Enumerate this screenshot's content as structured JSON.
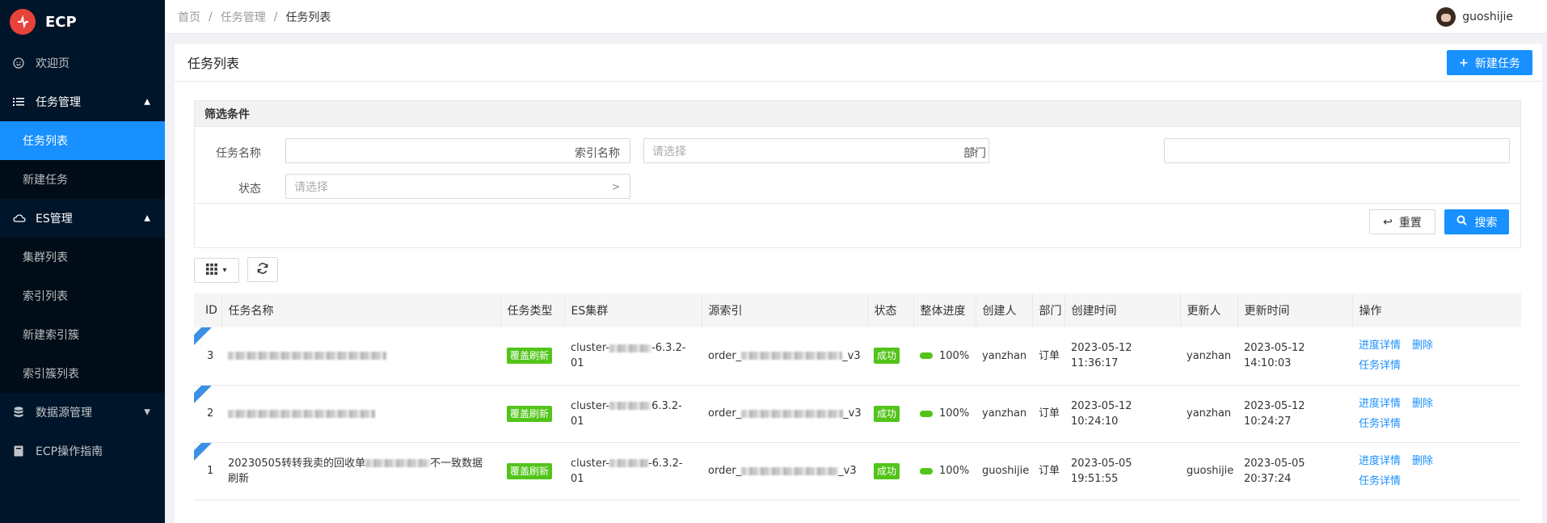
{
  "app": {
    "logo_text": "ECP",
    "brand_color": "#e8433b",
    "accent": "#1890ff"
  },
  "sidebar": {
    "items": [
      {
        "label": "欢迎页",
        "icon": "smile-icon"
      },
      {
        "label": "任务管理",
        "icon": "list-icon",
        "expanded": true,
        "children": [
          {
            "label": "任务列表",
            "active": true
          },
          {
            "label": "新建任务"
          }
        ]
      },
      {
        "label": "ES管理",
        "icon": "cloud-icon",
        "expanded": true,
        "children": [
          {
            "label": "集群列表"
          },
          {
            "label": "索引列表"
          },
          {
            "label": "新建索引簇"
          },
          {
            "label": "索引簇列表"
          }
        ]
      },
      {
        "label": "数据源管理",
        "icon": "database-icon",
        "expanded": false
      },
      {
        "label": "ECP操作指南",
        "icon": "book-icon"
      }
    ]
  },
  "header": {
    "breadcrumb": [
      "首页",
      "任务管理",
      "任务列表"
    ],
    "user": "guoshijie"
  },
  "page": {
    "title": "任务列表",
    "new_button": "新建任务"
  },
  "filter": {
    "title": "筛选条件",
    "task_name_label": "任务名称",
    "index_name_label": "索引名称",
    "index_name_placeholder": "请选择",
    "dept_label": "部门",
    "status_label": "状态",
    "status_placeholder": "请选择",
    "reset_button": "重置",
    "search_button": "搜索"
  },
  "table": {
    "columns": [
      "ID",
      "任务名称",
      "任务类型",
      "ES集群",
      "源索引",
      "状态",
      "整体进度",
      "创建人",
      "部门",
      "创建时间",
      "更新人",
      "更新时间",
      "操作"
    ],
    "rows": [
      {
        "id": "3",
        "name": "",
        "type": "覆盖刷新",
        "cluster_a": "cluster-",
        "cluster_b": "-6.3.2-",
        "cluster_c": "01",
        "index_a": "order_",
        "index_b": "_v3",
        "status": "成功",
        "progress": "100%",
        "creator": "yanzhan",
        "dept": "订单",
        "created_date": "2023-05-12",
        "created_time": "11:36:17",
        "updater": "yanzhan",
        "updated_date": "2023-05-12",
        "updated_time": "14:10:03",
        "op_progress": "进度详情",
        "op_delete": "删除",
        "op_detail": "任务详情"
      },
      {
        "id": "2",
        "name": "",
        "type": "覆盖刷新",
        "cluster_a": "cluster-",
        "cluster_b": "6.3.2-",
        "cluster_c": "01",
        "index_a": "order_",
        "index_b": "_v3",
        "status": "成功",
        "progress": "100%",
        "creator": "yanzhan",
        "dept": "订单",
        "created_date": "2023-05-12",
        "created_time": "10:24:10",
        "updater": "yanzhan",
        "updated_date": "2023-05-12",
        "updated_time": "10:24:27",
        "op_progress": "进度详情",
        "op_delete": "删除",
        "op_detail": "任务详情"
      },
      {
        "id": "1",
        "name_a": "20230505转转我卖的回收单",
        "name_b": "不一致数据",
        "name_c": "刷新",
        "type": "覆盖刷新",
        "cluster_a": "cluster-",
        "cluster_b": "-6.3.2-",
        "cluster_c": "01",
        "index_a": "order_",
        "index_b": "_v3",
        "status": "成功",
        "progress": "100%",
        "creator": "guoshijie",
        "dept": "订单",
        "created_date": "2023-05-05",
        "created_time": "19:51:55",
        "updater": "guoshijie",
        "updated_date": "2023-05-05",
        "updated_time": "20:37:24",
        "op_progress": "进度详情",
        "op_delete": "删除",
        "op_detail": "任务详情"
      }
    ]
  }
}
